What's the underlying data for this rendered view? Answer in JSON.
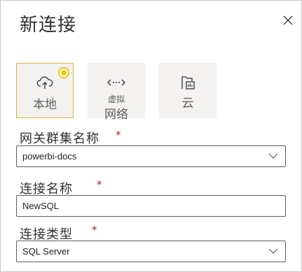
{
  "dialog": {
    "title": "新连接"
  },
  "connection_types": [
    {
      "label": "本地",
      "icon": "cloud-upload-icon",
      "selected": true
    },
    {
      "label_line1": "虚拟",
      "label_line2": "网络",
      "icon": "arrows-icon",
      "selected": false
    },
    {
      "label": "云",
      "icon": "cloud-file-icon",
      "selected": false
    }
  ],
  "fields": {
    "gateway_cluster": {
      "label": "网关群集名称",
      "required": "*",
      "value": "powerbi-docs"
    },
    "connection_name": {
      "label": "连接名称",
      "required": "*",
      "value": "NewSQL"
    },
    "connection_type": {
      "label": "连接类型",
      "required": "*",
      "value": "SQL Server"
    }
  },
  "colors": {
    "accent": "#f2c811",
    "selected_border": "#d8b935",
    "tile_bg": "#f3f2f1",
    "required": "#a4262c"
  }
}
